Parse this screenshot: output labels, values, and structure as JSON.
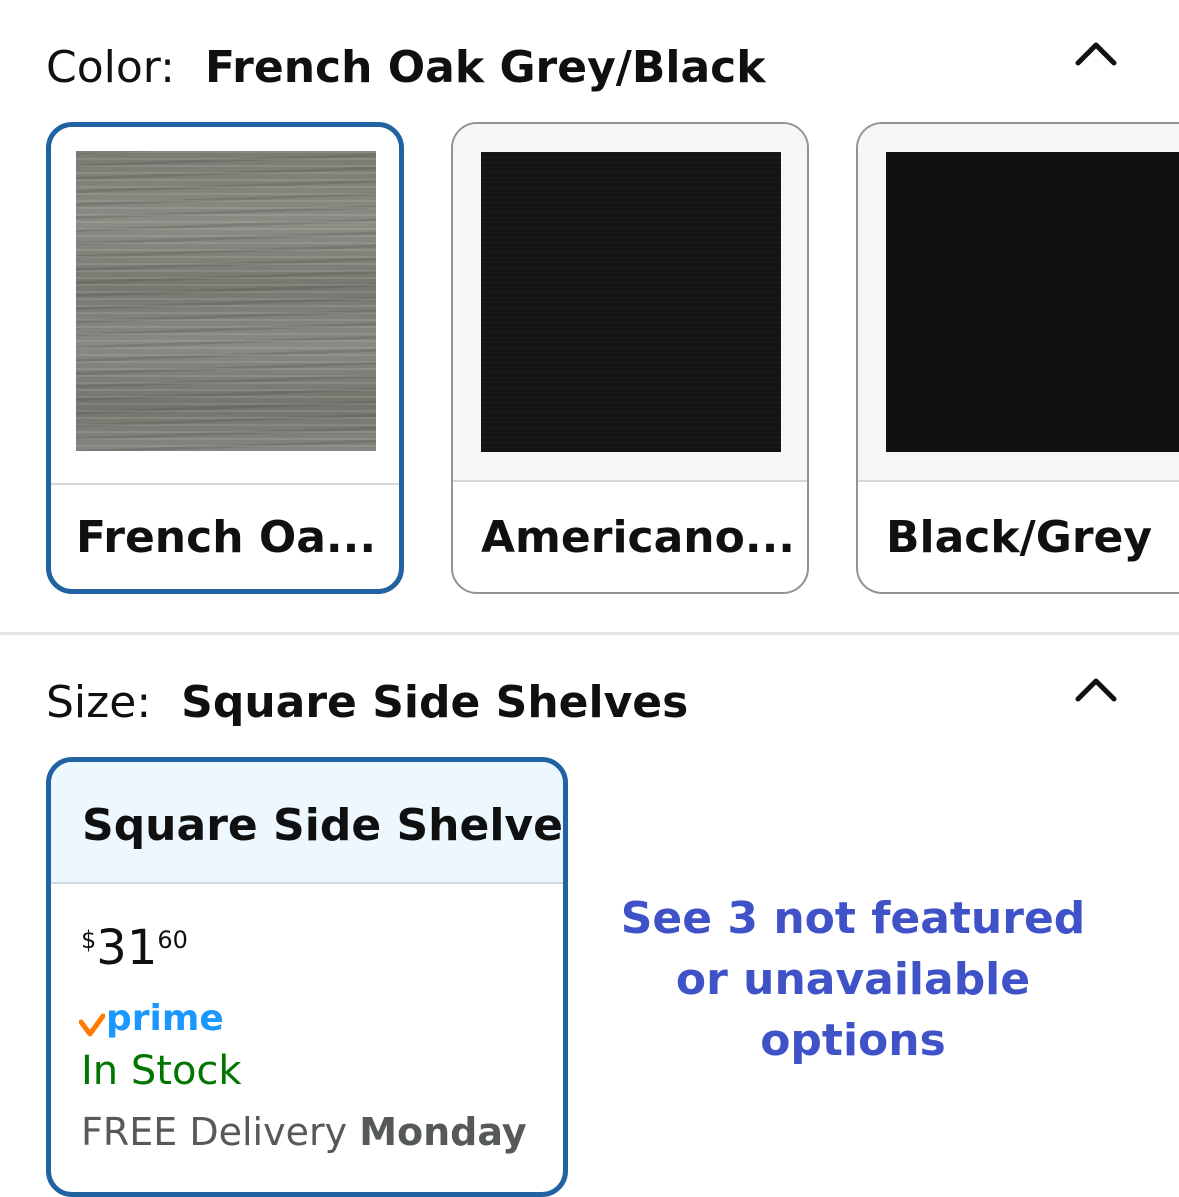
{
  "color": {
    "label": "Color:",
    "selected_value": "French Oak Grey/Black",
    "swatches": [
      {
        "name": "French Oa..."
      },
      {
        "name": "Americano..."
      },
      {
        "name": "Black/Grey"
      }
    ]
  },
  "size": {
    "label": "Size:",
    "selected_value": "Square Side Shelves",
    "option": {
      "title": "Square Side Shelves",
      "price_symbol": "$",
      "price_whole": "31",
      "price_fraction": "60",
      "prime_label": "prime",
      "stock": "In Stock",
      "delivery_prefix": "FREE Delivery",
      "delivery_day": "Monday"
    },
    "more_options": "See 3 not featured or unavailable options"
  },
  "colors": {
    "accent_blue": "#2162a1",
    "link": "#4052c8",
    "in_stock_green": "#007600",
    "prime_blue": "#1a98ff",
    "prime_check": "#ff7a00"
  },
  "icons": {
    "collapse": "chevron-up-icon",
    "prime": "prime-check-icon"
  }
}
